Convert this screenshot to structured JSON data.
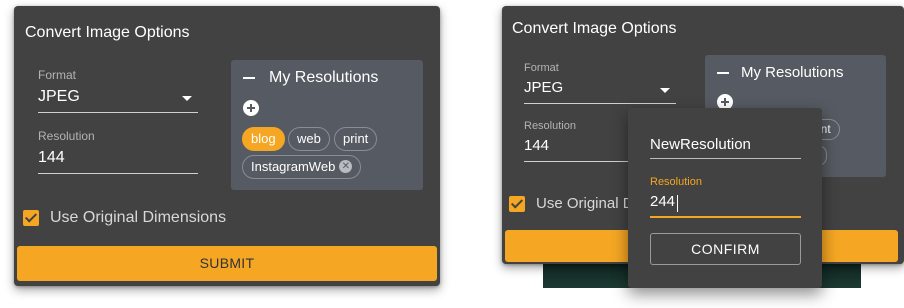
{
  "left": {
    "title": "Convert Image Options",
    "format": {
      "label": "Format",
      "value": "JPEG"
    },
    "resolution": {
      "label": "Resolution",
      "value": "144"
    },
    "my_resolutions": {
      "title": "My Resolutions",
      "chips": [
        {
          "label": "blog",
          "active": true
        },
        {
          "label": "web",
          "active": false
        },
        {
          "label": "print",
          "active": false
        },
        {
          "label": "InstagramWeb",
          "active": false,
          "removable": true
        }
      ]
    },
    "use_original": "Use Original Dimensions",
    "submit": "SUBMIT"
  },
  "right": {
    "title": "Convert Image Options",
    "format": {
      "label": "Format",
      "value": "JPEG"
    },
    "resolution": {
      "label": "Resolution",
      "value": "144"
    },
    "my_resolutions": {
      "title": "My Resolutions",
      "partial_chip": "int"
    },
    "use_original_partial": "Use Original D",
    "dialog": {
      "name_value": "NewResolution",
      "resolution_label": "Resolution",
      "resolution_value": "244",
      "confirm": "CONFIRM"
    }
  },
  "colors": {
    "panel": "#424242",
    "resolutions_box": "#565a62",
    "accent": "#f5a623"
  }
}
